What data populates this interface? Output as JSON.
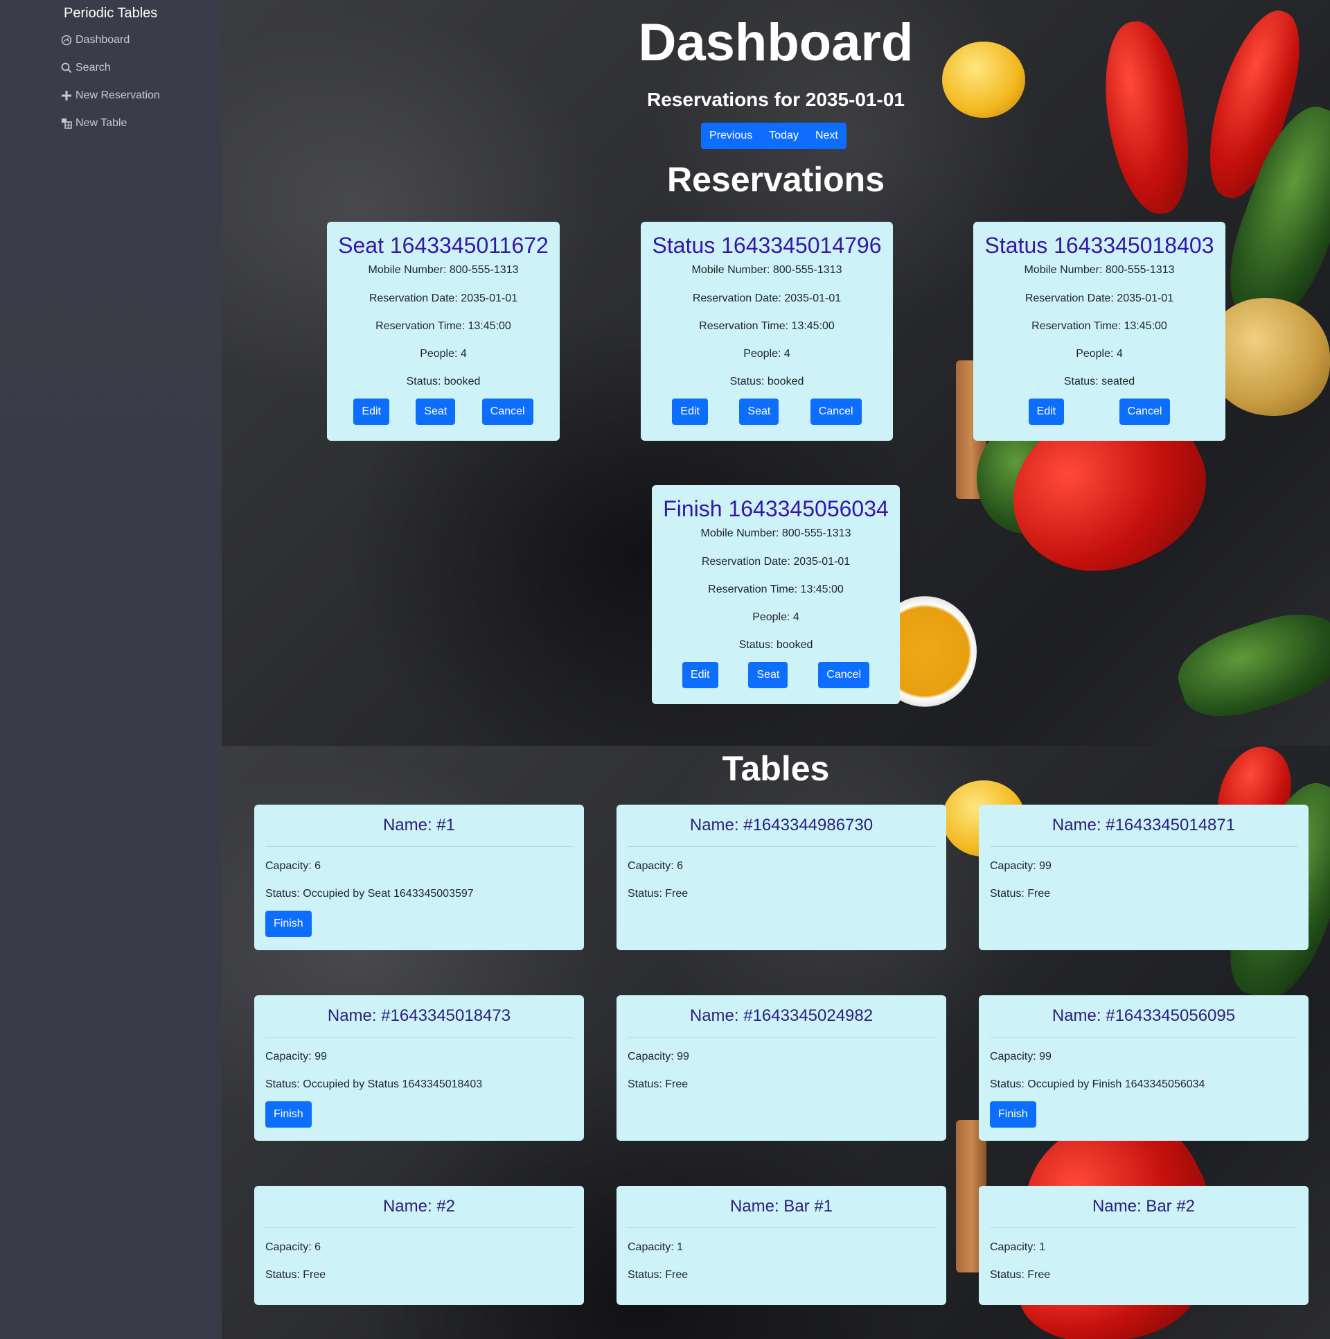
{
  "sidebar": {
    "brand": "Periodic Tables",
    "items": [
      {
        "label": "Dashboard",
        "icon": "dashboard-icon"
      },
      {
        "label": "Search",
        "icon": "search-icon"
      },
      {
        "label": "New Reservation",
        "icon": "plus-icon"
      },
      {
        "label": "New Table",
        "icon": "table-icon"
      }
    ]
  },
  "header": {
    "title": "Dashboard",
    "date_heading": "Reservations for 2035-01-01",
    "nav": {
      "previous": "Previous",
      "today": "Today",
      "next": "Next"
    },
    "reservations_heading": "Reservations",
    "tables_heading": "Tables"
  },
  "reservations": [
    {
      "title": "Seat 1643345011672",
      "mobile": "Mobile Number: 800-555-1313",
      "date": "Reservation Date: 2035-01-01",
      "time": "Reservation Time: 13:45:00",
      "people": "People: 4",
      "status": "Status: booked",
      "edit": "Edit",
      "seat": "Seat",
      "cancel": "Cancel"
    },
    {
      "title": "Status 1643345014796",
      "mobile": "Mobile Number: 800-555-1313",
      "date": "Reservation Date: 2035-01-01",
      "time": "Reservation Time: 13:45:00",
      "people": "People: 4",
      "status": "Status: booked",
      "edit": "Edit",
      "seat": "Seat",
      "cancel": "Cancel"
    },
    {
      "title": "Status 1643345018403",
      "mobile": "Mobile Number: 800-555-1313",
      "date": "Reservation Date: 2035-01-01",
      "time": "Reservation Time: 13:45:00",
      "people": "People: 4",
      "status": "Status: seated",
      "edit": "Edit",
      "cancel": "Cancel"
    },
    {
      "title": "Finish 1643345056034",
      "mobile": "Mobile Number: 800-555-1313",
      "date": "Reservation Date: 2035-01-01",
      "time": "Reservation Time: 13:45:00",
      "people": "People: 4",
      "status": "Status: booked",
      "edit": "Edit",
      "seat": "Seat",
      "cancel": "Cancel"
    }
  ],
  "tables": [
    {
      "name": "Name: #1",
      "capacity": "Capacity: 6",
      "status": "Status: Occupied by Seat 1643345003597",
      "finish": "Finish"
    },
    {
      "name": "Name: #1643344986730",
      "capacity": "Capacity: 6",
      "status": "Status: Free"
    },
    {
      "name": "Name: #1643345014871",
      "capacity": "Capacity: 99",
      "status": "Status: Free"
    },
    {
      "name": "Name: #1643345018473",
      "capacity": "Capacity: 99",
      "status": "Status: Occupied by Status 1643345018403",
      "finish": "Finish"
    },
    {
      "name": "Name: #1643345024982",
      "capacity": "Capacity: 99",
      "status": "Status: Free"
    },
    {
      "name": "Name: #1643345056095",
      "capacity": "Capacity: 99",
      "status": "Status: Occupied by Finish 1643345056034",
      "finish": "Finish"
    },
    {
      "name": "Name: #2",
      "capacity": "Capacity: 6",
      "status": "Status: Free"
    },
    {
      "name": "Name: Bar #1",
      "capacity": "Capacity: 1",
      "status": "Status: Free"
    },
    {
      "name": "Name: Bar #2",
      "capacity": "Capacity: 1",
      "status": "Status: Free"
    }
  ],
  "colors": {
    "accent": "#0d6efd",
    "card": "#cdf3f9",
    "card_title": "#3516a8",
    "sidebar": "#3a3c49"
  }
}
